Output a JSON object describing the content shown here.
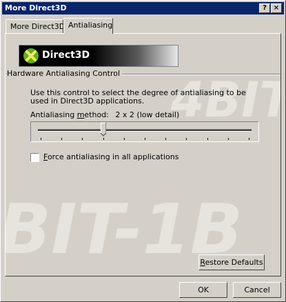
{
  "window": {
    "title": "More Direct3D",
    "help_button": "?",
    "close_button": "×"
  },
  "tabs": [
    {
      "label": "More Direct3D",
      "active": false
    },
    {
      "label": "Antialiasing",
      "active": true
    }
  ],
  "panel": {
    "watermark_top": "4BIT-",
    "watermark_bottom": "BIT-1B",
    "banner_label": "Direct3D",
    "group_title": "Hardware Antialiasing Control",
    "description": "Use this control to select the degree of antialiasing to be used in Direct3D applications.",
    "method_label_prefix": "Antialiasing ",
    "method_label_accel": "m",
    "method_label_suffix": "ethod:",
    "method_value": "2 x 2 (low detail)",
    "slider": {
      "position": 3,
      "tick_count": 11
    },
    "force_checkbox": {
      "accel": "F",
      "label_rest": "orce antialiasing in all applications",
      "checked": false
    },
    "restore_button": {
      "accel": "R",
      "label_rest": "estore Defaults"
    }
  },
  "buttons": {
    "ok": "OK",
    "cancel": "Cancel"
  },
  "colors": {
    "titlebar": "#0a246a",
    "face": "#d4d0c8",
    "logo_green": "#66aa22"
  }
}
